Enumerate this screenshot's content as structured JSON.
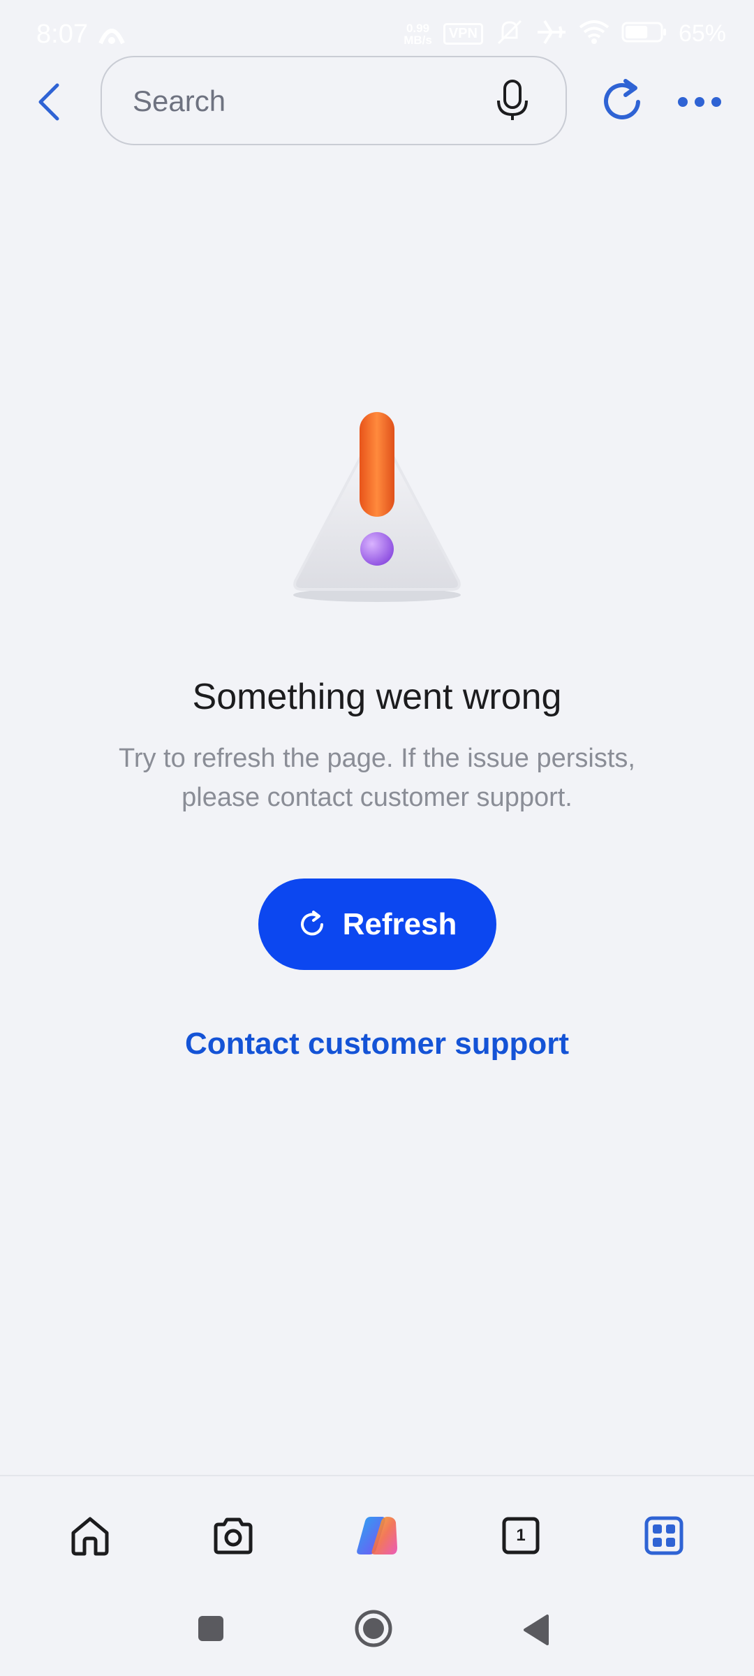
{
  "status_bar": {
    "time": "8:07",
    "speed_value": "0.99",
    "speed_unit": "MB/s",
    "vpn_label": "VPN",
    "battery_percent": "65%",
    "battery_level": 0.65,
    "icons": [
      "hotspot-icon",
      "mute-icon",
      "airplane-icon",
      "wifi-icon",
      "battery-icon"
    ]
  },
  "toolbar": {
    "search_placeholder": "Search",
    "icons": [
      "back-icon",
      "mic-icon",
      "reload-icon",
      "more-icon"
    ]
  },
  "error": {
    "title": "Something went wrong",
    "description": "Try to refresh the page. If the issue persists, please contact customer support.",
    "refresh_label": "Refresh",
    "support_label": "Contact customer support"
  },
  "bottom_nav": {
    "items": [
      {
        "icon": "home-icon"
      },
      {
        "icon": "camera-icon"
      },
      {
        "icon": "copilot-icon"
      },
      {
        "icon": "tabs-icon",
        "count": "1"
      },
      {
        "icon": "apps-icon",
        "active": true
      }
    ]
  },
  "colors": {
    "accent": "#0c47f0",
    "link": "#1453d6",
    "icon_blue": "#2f63d4",
    "background": "#f2f3f7"
  }
}
